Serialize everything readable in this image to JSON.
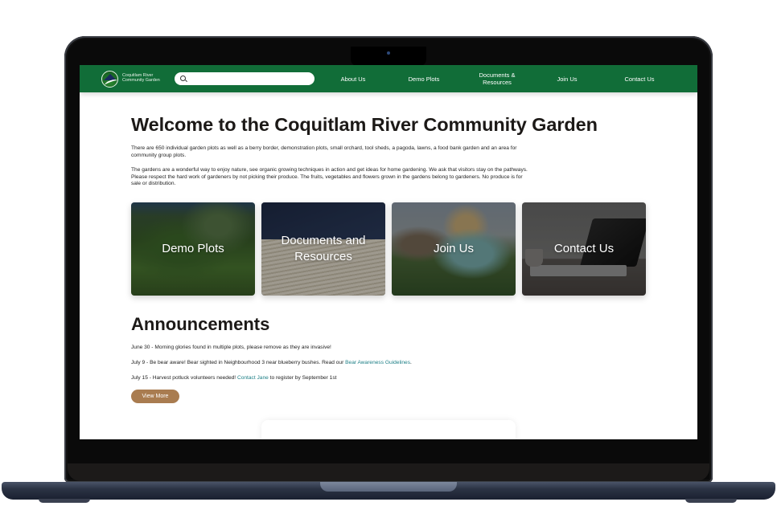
{
  "nav": {
    "logo_line1": "Coquitlam River",
    "logo_line2": "Community Garden",
    "search_placeholder": "",
    "links": [
      {
        "label": "About Us"
      },
      {
        "label": "Demo Plots"
      },
      {
        "label_line1": "Documents &",
        "label_line2": "Resources"
      },
      {
        "label": "Join Us"
      },
      {
        "label": "Contact Us"
      }
    ]
  },
  "hero": {
    "title": "Welcome to the Coquitlam River Community Garden",
    "paragraph1": "There are 650 individual garden plots as well as a berry border, demonstration plots, small orchard, tool sheds, a pagoda, lawns, a food bank garden and an area for community group plots.",
    "paragraph2": "The gardens are a wonderful way to enjoy nature, see organic growing techniques in action and get ideas for home gardening. We ask that visitors stay on the pathways. Please respect the hard work of gardeners by not picking their produce. The fruits, vegetables and flowers grown in the gardens belong to gardeners. No produce is for sale or distribution."
  },
  "cards": [
    {
      "label": "Demo Plots"
    },
    {
      "label": "Documents and Resources"
    },
    {
      "label": "Join Us"
    },
    {
      "label": "Contact Us"
    }
  ],
  "announcements": {
    "title": "Announcements",
    "items": [
      {
        "text": "June 30 - Morning glories found in multiple plots, please remove as they are invasive!"
      },
      {
        "text_before": "July 9 - Be bear aware! Bear sighted in Neighbourhood 3 near blueberry bushes. Read our ",
        "link": "Bear Awareness Guidelines",
        "text_after": "."
      },
      {
        "text_before": "July 15 - Harvest potluck volunteers needed! ",
        "link": "Contact Jane",
        "text_after": " to register by September 1st"
      }
    ],
    "button_label": "View More"
  },
  "colors": {
    "nav_green": "#116d38",
    "link_teal": "#1d7f86",
    "button_brown": "#a97c50",
    "heading": "#1c1917"
  }
}
